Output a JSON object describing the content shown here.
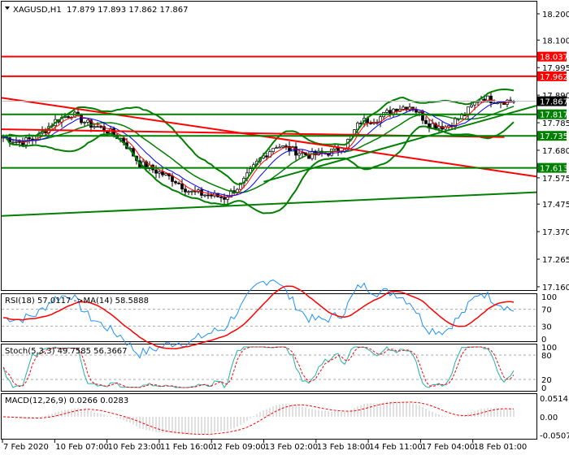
{
  "header": {
    "symbol": "XAGUSD,H1",
    "ohlc": "17.879 17.893 17.862 17.867"
  },
  "colors": {
    "bull": "#000000",
    "bear": "#000000",
    "resistance": "#ff0000",
    "support": "#008000",
    "current": "#000000",
    "rsi": "#1e90ff",
    "rsi_ma": "#ff0000",
    "stoch_main": "#20b2aa",
    "stoch_signal": "#ff0000",
    "macd_hist": "#c0c0c0",
    "macd_signal": "#ff0000"
  },
  "chart_data": {
    "type": "candlestick",
    "price_axis": {
      "ticks": [
        "18.200",
        "18.100",
        "17.995",
        "17.890",
        "17.785",
        "17.680",
        "17.575",
        "17.475",
        "17.370",
        "17.265",
        "17.160"
      ],
      "range": [
        17.16,
        18.2
      ]
    },
    "time_axis": {
      "ticks": [
        "7 Feb 2020",
        "10 Feb 07:00",
        "10 Feb 23:00",
        "11 Feb 16:00",
        "12 Feb 09:00",
        "13 Feb 02:00",
        "13 Feb 18:00",
        "14 Feb 11:00",
        "17 Feb 04:00",
        "18 Feb 01:00"
      ]
    },
    "close_keypoints": [
      17.73,
      17.71,
      17.73,
      17.79,
      17.82,
      17.78,
      17.76,
      17.72,
      17.63,
      17.6,
      17.57,
      17.52,
      17.51,
      17.5,
      17.55,
      17.64,
      17.7,
      17.68,
      17.66,
      17.67,
      17.69,
      17.79,
      17.8,
      17.84,
      17.85,
      17.78,
      17.77,
      17.81,
      17.88,
      17.87,
      17.867
    ],
    "levels": [
      {
        "label": "18.037",
        "price": 18.037,
        "kind": "resistance"
      },
      {
        "label": "17.962",
        "price": 17.962,
        "kind": "resistance"
      },
      {
        "label": "17.867",
        "price": 17.867,
        "kind": "current"
      },
      {
        "label": "17.817",
        "price": 17.817,
        "kind": "support"
      },
      {
        "label": "17.735",
        "price": 17.735,
        "kind": "support"
      },
      {
        "label": "17.613",
        "price": 17.613,
        "kind": "support"
      }
    ],
    "trendlines": [
      {
        "kind": "resistance",
        "from": [
          0,
          17.88
        ],
        "to": [
          1,
          17.58
        ]
      },
      {
        "kind": "resistance",
        "from": [
          0,
          17.76
        ],
        "to": [
          0.94,
          17.73
        ]
      },
      {
        "kind": "support",
        "from": [
          0,
          17.43
        ],
        "to": [
          1,
          17.52
        ]
      },
      {
        "kind": "support",
        "from": [
          0.49,
          17.56
        ],
        "to": [
          1,
          17.85
        ]
      }
    ]
  },
  "rsi": {
    "label": "RSI(18) 57.0117  ->MA(14) 58.5888",
    "ticks": [
      "100",
      "70",
      "30",
      "0"
    ]
  },
  "stoch": {
    "label": "Stoch(5,3,3) 49.7585 56.3667",
    "ticks": [
      "100",
      "80",
      "20",
      "0"
    ]
  },
  "macd": {
    "label": "MACD(12,26,9) 0.0266 0.0283",
    "ticks": [
      "0.0514",
      "0.00",
      "-0.0507"
    ]
  }
}
